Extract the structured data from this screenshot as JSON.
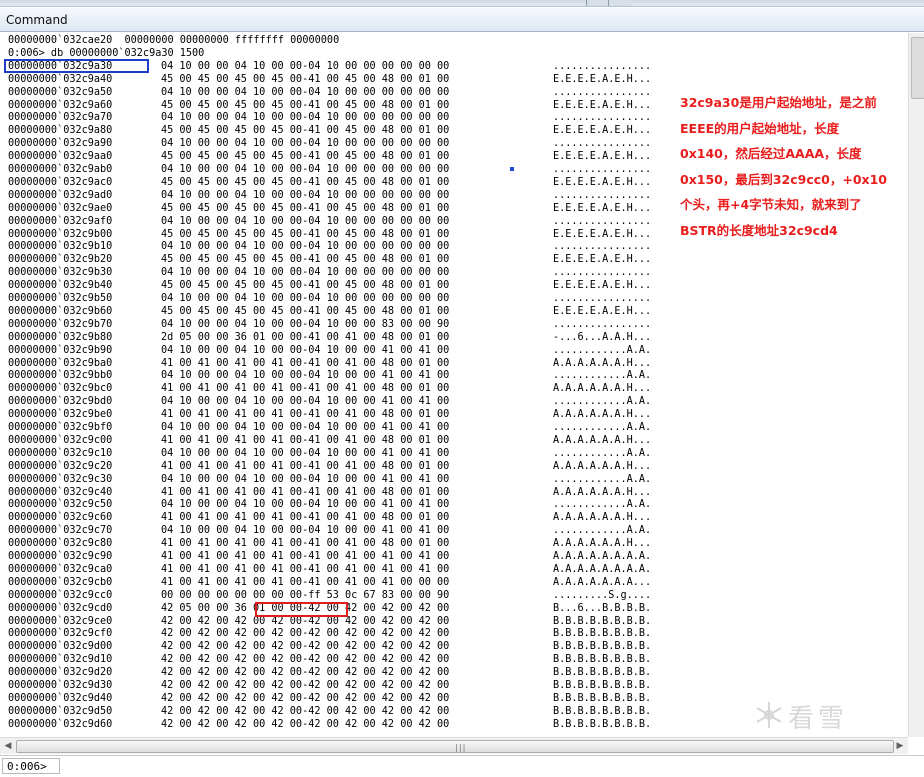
{
  "window": {
    "title": "Command"
  },
  "header_lines": [
    "00000000`032cae20  00000000 00000000 ffffffff 00000000",
    "0:006> db 00000000`032c9a30 1500"
  ],
  "dump_rows": [
    {
      "addr": "00000000`032c9a30",
      "hex": "04 10 00 00 04 10 00 00-04 10 00 00 00 00 00 00",
      "ascii": "................"
    },
    {
      "addr": "00000000`032c9a40",
      "hex": "45 00 45 00 45 00 45 00-41 00 45 00 48 00 01 00",
      "ascii": "E.E.E.E.A.E.H..."
    },
    {
      "addr": "00000000`032c9a50",
      "hex": "04 10 00 00 04 10 00 00-04 10 00 00 00 00 00 00",
      "ascii": "................"
    },
    {
      "addr": "00000000`032c9a60",
      "hex": "45 00 45 00 45 00 45 00-41 00 45 00 48 00 01 00",
      "ascii": "E.E.E.E.A.E.H..."
    },
    {
      "addr": "00000000`032c9a70",
      "hex": "04 10 00 00 04 10 00 00-04 10 00 00 00 00 00 00",
      "ascii": "................"
    },
    {
      "addr": "00000000`032c9a80",
      "hex": "45 00 45 00 45 00 45 00-41 00 45 00 48 00 01 00",
      "ascii": "E.E.E.E.A.E.H..."
    },
    {
      "addr": "00000000`032c9a90",
      "hex": "04 10 00 00 04 10 00 00-04 10 00 00 00 00 00 00",
      "ascii": "................"
    },
    {
      "addr": "00000000`032c9aa0",
      "hex": "45 00 45 00 45 00 45 00-41 00 45 00 48 00 01 00",
      "ascii": "E.E.E.E.A.E.H..."
    },
    {
      "addr": "00000000`032c9ab0",
      "hex": "04 10 00 00 04 10 00 00-04 10 00 00 00 00 00 00",
      "ascii": "................"
    },
    {
      "addr": "00000000`032c9ac0",
      "hex": "45 00 45 00 45 00 45 00-41 00 45 00 48 00 01 00",
      "ascii": "E.E.E.E.A.E.H..."
    },
    {
      "addr": "00000000`032c9ad0",
      "hex": "04 10 00 00 04 10 00 00-04 10 00 00 00 00 00 00",
      "ascii": "................"
    },
    {
      "addr": "00000000`032c9ae0",
      "hex": "45 00 45 00 45 00 45 00-41 00 45 00 48 00 01 00",
      "ascii": "E.E.E.E.A.E.H..."
    },
    {
      "addr": "00000000`032c9af0",
      "hex": "04 10 00 00 04 10 00 00-04 10 00 00 00 00 00 00",
      "ascii": "................"
    },
    {
      "addr": "00000000`032c9b00",
      "hex": "45 00 45 00 45 00 45 00-41 00 45 00 48 00 01 00",
      "ascii": "E.E.E.E.A.E.H..."
    },
    {
      "addr": "00000000`032c9b10",
      "hex": "04 10 00 00 04 10 00 00-04 10 00 00 00 00 00 00",
      "ascii": "................"
    },
    {
      "addr": "00000000`032c9b20",
      "hex": "45 00 45 00 45 00 45 00-41 00 45 00 48 00 01 00",
      "ascii": "E.E.E.E.A.E.H..."
    },
    {
      "addr": "00000000`032c9b30",
      "hex": "04 10 00 00 04 10 00 00-04 10 00 00 00 00 00 00",
      "ascii": "................"
    },
    {
      "addr": "00000000`032c9b40",
      "hex": "45 00 45 00 45 00 45 00-41 00 45 00 48 00 01 00",
      "ascii": "E.E.E.E.A.E.H..."
    },
    {
      "addr": "00000000`032c9b50",
      "hex": "04 10 00 00 04 10 00 00-04 10 00 00 00 00 00 00",
      "ascii": "................"
    },
    {
      "addr": "00000000`032c9b60",
      "hex": "45 00 45 00 45 00 45 00-41 00 45 00 48 00 01 00",
      "ascii": "E.E.E.E.A.E.H..."
    },
    {
      "addr": "00000000`032c9b70",
      "hex": "04 10 00 00 04 10 00 00-04 10 00 00 83 00 00 90",
      "ascii": "................"
    },
    {
      "addr": "00000000`032c9b80",
      "hex": "2d 05 00 00 36 01 00 00-41 00 41 00 48 00 01 00",
      "ascii": "-...6...A.A.H..."
    },
    {
      "addr": "00000000`032c9b90",
      "hex": "04 10 00 00 04 10 00 00-04 10 00 00 41 00 41 00",
      "ascii": "............A.A."
    },
    {
      "addr": "00000000`032c9ba0",
      "hex": "41 00 41 00 41 00 41 00-41 00 41 00 48 00 01 00",
      "ascii": "A.A.A.A.A.A.H..."
    },
    {
      "addr": "00000000`032c9bb0",
      "hex": "04 10 00 00 04 10 00 00-04 10 00 00 41 00 41 00",
      "ascii": "............A.A."
    },
    {
      "addr": "00000000`032c9bc0",
      "hex": "41 00 41 00 41 00 41 00-41 00 41 00 48 00 01 00",
      "ascii": "A.A.A.A.A.A.H..."
    },
    {
      "addr": "00000000`032c9bd0",
      "hex": "04 10 00 00 04 10 00 00-04 10 00 00 41 00 41 00",
      "ascii": "............A.A."
    },
    {
      "addr": "00000000`032c9be0",
      "hex": "41 00 41 00 41 00 41 00-41 00 41 00 48 00 01 00",
      "ascii": "A.A.A.A.A.A.H..."
    },
    {
      "addr": "00000000`032c9bf0",
      "hex": "04 10 00 00 04 10 00 00-04 10 00 00 41 00 41 00",
      "ascii": "............A.A."
    },
    {
      "addr": "00000000`032c9c00",
      "hex": "41 00 41 00 41 00 41 00-41 00 41 00 48 00 01 00",
      "ascii": "A.A.A.A.A.A.H..."
    },
    {
      "addr": "00000000`032c9c10",
      "hex": "04 10 00 00 04 10 00 00-04 10 00 00 41 00 41 00",
      "ascii": "............A.A."
    },
    {
      "addr": "00000000`032c9c20",
      "hex": "41 00 41 00 41 00 41 00-41 00 41 00 48 00 01 00",
      "ascii": "A.A.A.A.A.A.H..."
    },
    {
      "addr": "00000000`032c9c30",
      "hex": "04 10 00 00 04 10 00 00-04 10 00 00 41 00 41 00",
      "ascii": "............A.A."
    },
    {
      "addr": "00000000`032c9c40",
      "hex": "41 00 41 00 41 00 41 00-41 00 41 00 48 00 01 00",
      "ascii": "A.A.A.A.A.A.H..."
    },
    {
      "addr": "00000000`032c9c50",
      "hex": "04 10 00 00 04 10 00 00-04 10 00 00 41 00 41 00",
      "ascii": "............A.A."
    },
    {
      "addr": "00000000`032c9c60",
      "hex": "41 00 41 00 41 00 41 00-41 00 41 00 48 00 01 00",
      "ascii": "A.A.A.A.A.A.H..."
    },
    {
      "addr": "00000000`032c9c70",
      "hex": "04 10 00 00 04 10 00 00-04 10 00 00 41 00 41 00",
      "ascii": "............A.A."
    },
    {
      "addr": "00000000`032c9c80",
      "hex": "41 00 41 00 41 00 41 00-41 00 41 00 48 00 01 00",
      "ascii": "A.A.A.A.A.A.H..."
    },
    {
      "addr": "00000000`032c9c90",
      "hex": "41 00 41 00 41 00 41 00-41 00 41 00 41 00 41 00",
      "ascii": "A.A.A.A.A.A.A.A."
    },
    {
      "addr": "00000000`032c9ca0",
      "hex": "41 00 41 00 41 00 41 00-41 00 41 00 41 00 41 00",
      "ascii": "A.A.A.A.A.A.A.A."
    },
    {
      "addr": "00000000`032c9cb0",
      "hex": "41 00 41 00 41 00 41 00-41 00 41 00 41 00 00 00",
      "ascii": "A.A.A.A.A.A.A..."
    },
    {
      "addr": "00000000`032c9cc0",
      "hex": "00 00 00 00 00 00 00 00-ff 53 0c 67 83 00 00 90",
      "ascii": ".........S.g...."
    },
    {
      "addr": "00000000`032c9cd0",
      "hex": "42 05 00 00 36 01 00 00-42 00 42 00 42 00 42 00",
      "ascii": "B...6...B.B.B.B."
    },
    {
      "addr": "00000000`032c9ce0",
      "hex": "42 00 42 00 42 00 42 00-42 00 42 00 42 00 42 00",
      "ascii": "B.B.B.B.B.B.B.B."
    },
    {
      "addr": "00000000`032c9cf0",
      "hex": "42 00 42 00 42 00 42 00-42 00 42 00 42 00 42 00",
      "ascii": "B.B.B.B.B.B.B.B."
    },
    {
      "addr": "00000000`032c9d00",
      "hex": "42 00 42 00 42 00 42 00-42 00 42 00 42 00 42 00",
      "ascii": "B.B.B.B.B.B.B.B."
    },
    {
      "addr": "00000000`032c9d10",
      "hex": "42 00 42 00 42 00 42 00-42 00 42 00 42 00 42 00",
      "ascii": "B.B.B.B.B.B.B.B."
    },
    {
      "addr": "00000000`032c9d20",
      "hex": "42 00 42 00 42 00 42 00-42 00 42 00 42 00 42 00",
      "ascii": "B.B.B.B.B.B.B.B."
    },
    {
      "addr": "00000000`032c9d30",
      "hex": "42 00 42 00 42 00 42 00-42 00 42 00 42 00 42 00",
      "ascii": "B.B.B.B.B.B.B.B."
    },
    {
      "addr": "00000000`032c9d40",
      "hex": "42 00 42 00 42 00 42 00-42 00 42 00 42 00 42 00",
      "ascii": "B.B.B.B.B.B.B.B."
    },
    {
      "addr": "00000000`032c9d50",
      "hex": "42 00 42 00 42 00 42 00-42 00 42 00 42 00 42 00",
      "ascii": "B.B.B.B.B.B.B.B."
    },
    {
      "addr": "00000000`032c9d60",
      "hex": "42 00 42 00 42 00 42 00-42 00 42 00 42 00 42 00",
      "ascii": "B.B.B.B.B.B.B.B."
    }
  ],
  "annotation_lines": [
    "32c9a30是用户起始地址，是之前",
    "EEEE的用户起始地址，长度",
    "0x140，然后经过AAAA，长度",
    "0x150，最后到32c9cc0，+0x10",
    "个头，再+4字节未知，就来到了",
    "BSTR的长度地址32c9cd4"
  ],
  "command_bar": {
    "prompt": "0:006>",
    "input_value": ""
  },
  "watermark": {
    "text": "看雪"
  },
  "colors": {
    "annotation": "#ea1d1d",
    "highlight_blue": "#1e3ec8",
    "highlight_red": "#e01d1d"
  }
}
